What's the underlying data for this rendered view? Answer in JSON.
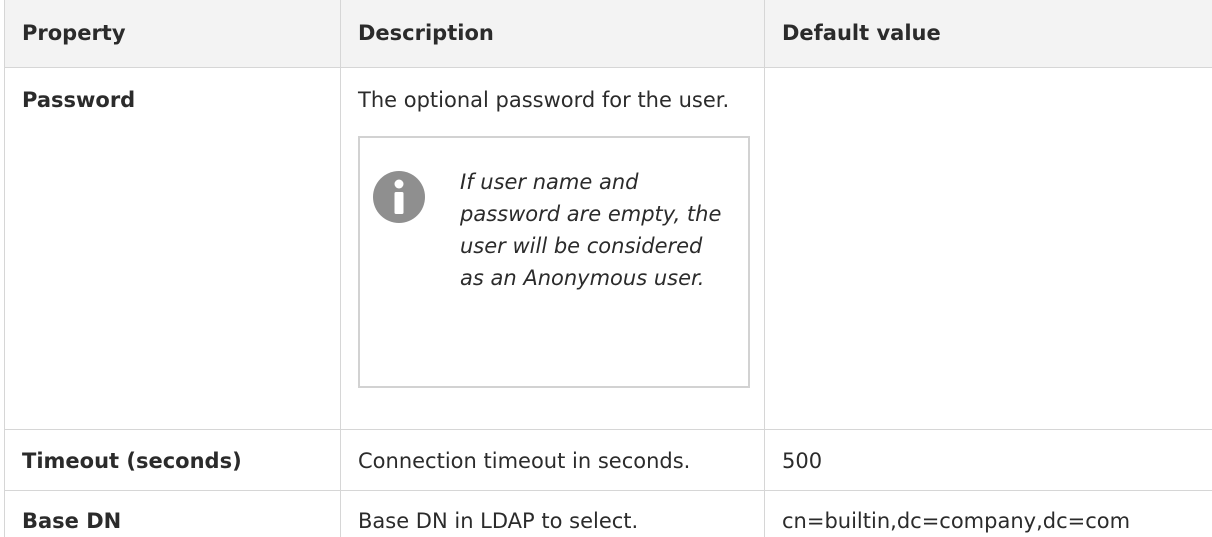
{
  "headers": {
    "property": "Property",
    "description": "Description",
    "default_value": "Default value"
  },
  "rows": [
    {
      "property": "Password",
      "description": "The optional password for the user.",
      "note": {
        "icon": "info-icon",
        "text": "If user name and password are empty, the user will be considered as an Anonymous user."
      },
      "default_value": ""
    },
    {
      "property": "Timeout (seconds)",
      "description": "Connection timeout in seconds.",
      "default_value": "500"
    },
    {
      "property": "Base DN",
      "description": "Base DN in LDAP to select.",
      "default_value": "cn=builtin,dc=company,dc=com"
    }
  ],
  "colors": {
    "header_bg": "#f3f3f3",
    "border": "#d6d6d6",
    "icon": "#8f8f8f"
  }
}
